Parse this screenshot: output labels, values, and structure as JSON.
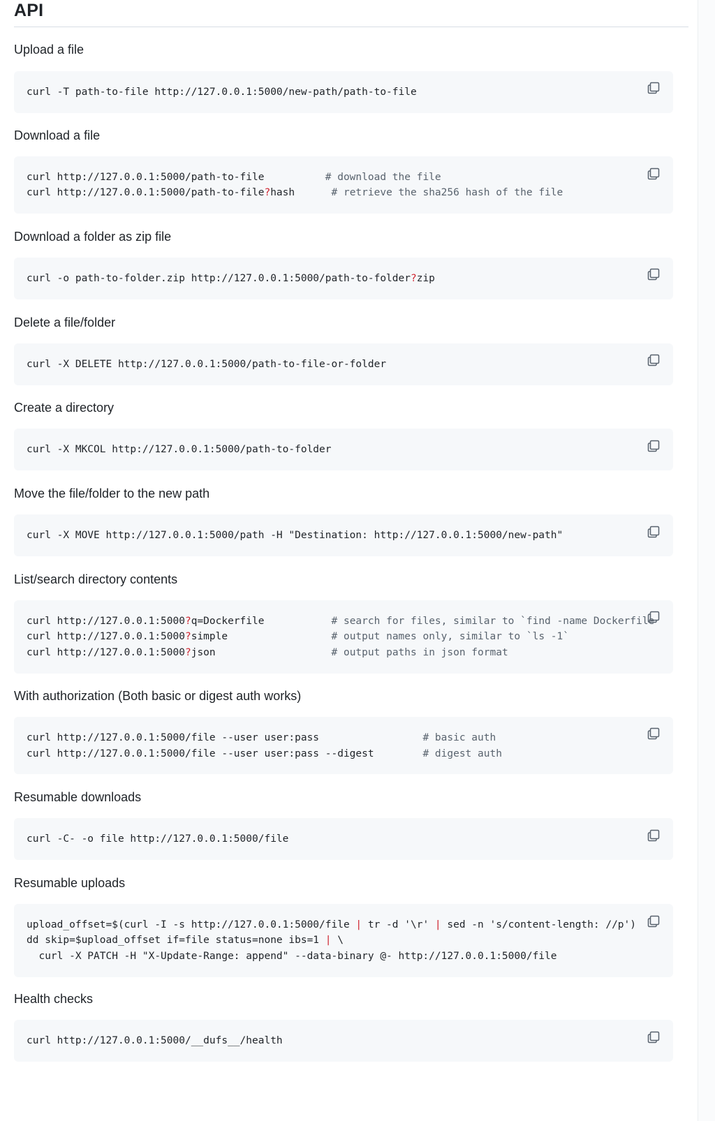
{
  "heading": "API",
  "sections": [
    {
      "title": "Upload a file",
      "lines": [
        [
          {
            "t": "curl -T path-to-file http://127.0.0.1:5000/new-path/path-to-file"
          }
        ]
      ]
    },
    {
      "title": "Download a file",
      "lines": [
        [
          {
            "t": "curl http://127.0.0.1:5000/path-to-file          "
          },
          {
            "t": "# download the file",
            "k": "c"
          }
        ],
        [
          {
            "t": "curl http://127.0.0.1:5000/path-to-file"
          },
          {
            "t": "?",
            "k": "q"
          },
          {
            "t": "hash      "
          },
          {
            "t": "# retrieve the sha256 hash of the file",
            "k": "c"
          }
        ]
      ]
    },
    {
      "title": "Download a folder as zip file",
      "lines": [
        [
          {
            "t": "curl -o path-to-folder.zip http://127.0.0.1:5000/path-to-folder"
          },
          {
            "t": "?",
            "k": "q"
          },
          {
            "t": "zip"
          }
        ]
      ]
    },
    {
      "title": "Delete a file/folder",
      "lines": [
        [
          {
            "t": "curl -X DELETE http://127.0.0.1:5000/path-to-file-or-folder"
          }
        ]
      ]
    },
    {
      "title": "Create a directory",
      "lines": [
        [
          {
            "t": "curl -X MKCOL http://127.0.0.1:5000/path-to-folder"
          }
        ]
      ]
    },
    {
      "title": "Move the file/folder to the new path",
      "lines": [
        [
          {
            "t": "curl -X MOVE http://127.0.0.1:5000/path -H \"Destination: http://127.0.0.1:5000/new-path\""
          }
        ]
      ]
    },
    {
      "title": "List/search directory contents",
      "lines": [
        [
          {
            "t": "curl http://127.0.0.1:5000"
          },
          {
            "t": "?",
            "k": "q"
          },
          {
            "t": "q=Dockerfile           "
          },
          {
            "t": "# search for files, similar to `find -name Dockerfile",
            "k": "c"
          }
        ],
        [
          {
            "t": "curl http://127.0.0.1:5000"
          },
          {
            "t": "?",
            "k": "q"
          },
          {
            "t": "simple                 "
          },
          {
            "t": "# output names only, similar to `ls -1`",
            "k": "c"
          }
        ],
        [
          {
            "t": "curl http://127.0.0.1:5000"
          },
          {
            "t": "?",
            "k": "q"
          },
          {
            "t": "json                   "
          },
          {
            "t": "# output paths in json format",
            "k": "c"
          }
        ]
      ]
    },
    {
      "title": "With authorization (Both basic or digest auth works)",
      "lines": [
        [
          {
            "t": "curl http://127.0.0.1:5000/file --user user:pass                 "
          },
          {
            "t": "# basic auth",
            "k": "c"
          }
        ],
        [
          {
            "t": "curl http://127.0.0.1:5000/file --user user:pass --digest        "
          },
          {
            "t": "# digest auth",
            "k": "c"
          }
        ]
      ]
    },
    {
      "title": "Resumable downloads",
      "lines": [
        [
          {
            "t": "curl -C- -o file http://127.0.0.1:5000/file"
          }
        ]
      ]
    },
    {
      "title": "Resumable uploads",
      "lines": [
        [
          {
            "t": "upload_offset=$(curl -I -s http://127.0.0.1:5000/file "
          },
          {
            "t": "|",
            "k": "q"
          },
          {
            "t": " tr -d '\\r' "
          },
          {
            "t": "|",
            "k": "q"
          },
          {
            "t": " sed -n 's/content-length: //p')"
          }
        ],
        [
          {
            "t": "dd skip=$upload_offset if=file status=none ibs=1 "
          },
          {
            "t": "|",
            "k": "q"
          },
          {
            "t": " \\"
          }
        ],
        [
          {
            "t": "  curl -X PATCH -H \"X-Update-Range: append\" --data-binary @- http://127.0.0.1:5000/file"
          }
        ]
      ]
    },
    {
      "title": "Health checks",
      "lines": [
        [
          {
            "t": "curl http://127.0.0.1:5000/__dufs__/health"
          }
        ]
      ]
    }
  ],
  "copy_icon": "copy-icon",
  "colors": {
    "code_bg": "#f6f8fa",
    "text": "#1f2328",
    "comment": "#59636e",
    "operator": "#cf222e",
    "rule": "#d8dee4"
  }
}
